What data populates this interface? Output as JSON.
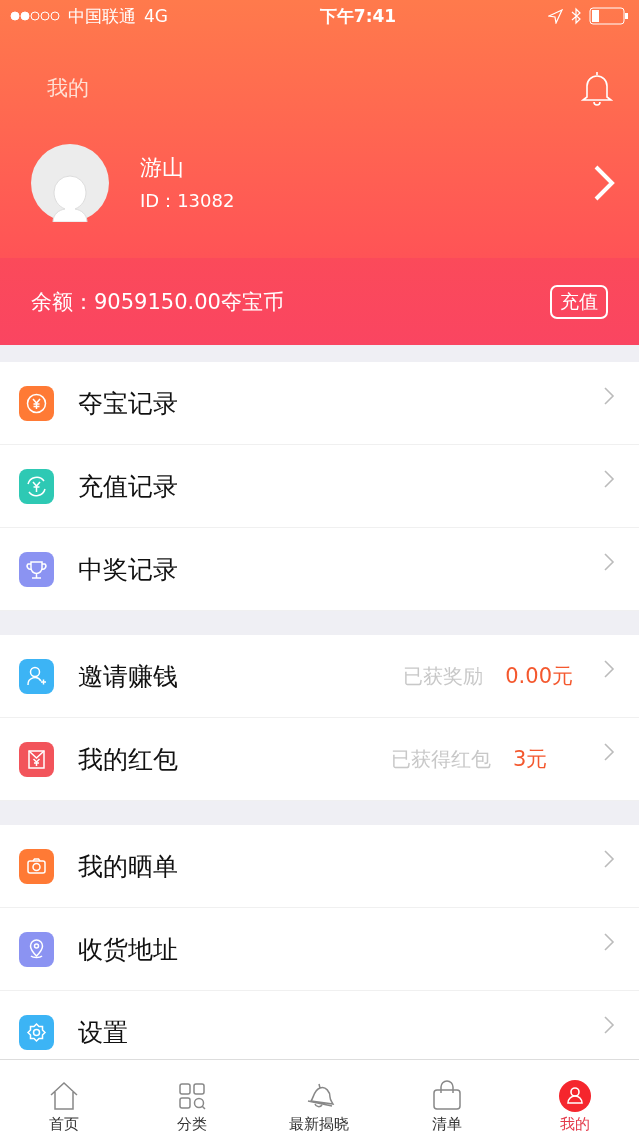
{
  "status_bar": {
    "carrier": "中国联通",
    "network": "4G",
    "time": "下午7:41"
  },
  "header": {
    "title": "我的"
  },
  "profile": {
    "name": "游山",
    "id": "ID：13082"
  },
  "balance": {
    "text": "余额：9059150.00夺宝币",
    "button": "充值"
  },
  "sections": [
    {
      "items": [
        {
          "label": "夺宝记录",
          "color": "#ff7a35"
        },
        {
          "label": "充值记录",
          "color": "#2ec9b4"
        },
        {
          "label": "中奖记录",
          "color": "#8b93f2"
        }
      ]
    },
    {
      "items": [
        {
          "label": "邀请赚钱",
          "color": "#3cb4f5",
          "note": "已获奖励",
          "value": "0.00元"
        },
        {
          "label": "我的红包",
          "color": "#f2545b",
          "note": "已获得红包",
          "value": "3元"
        }
      ]
    },
    {
      "items": [
        {
          "label": "我的晒单",
          "color": "#ff7a35"
        },
        {
          "label": "收货地址",
          "color": "#8b93f2"
        },
        {
          "label": "设置",
          "color": "#3cb4f5"
        }
      ]
    }
  ],
  "tab_bar": [
    {
      "label": "首页",
      "selected": false
    },
    {
      "label": "分类",
      "selected": false
    },
    {
      "label": "最新揭晓",
      "selected": false
    },
    {
      "label": "清单",
      "selected": false
    },
    {
      "label": "我的",
      "selected": true
    }
  ]
}
